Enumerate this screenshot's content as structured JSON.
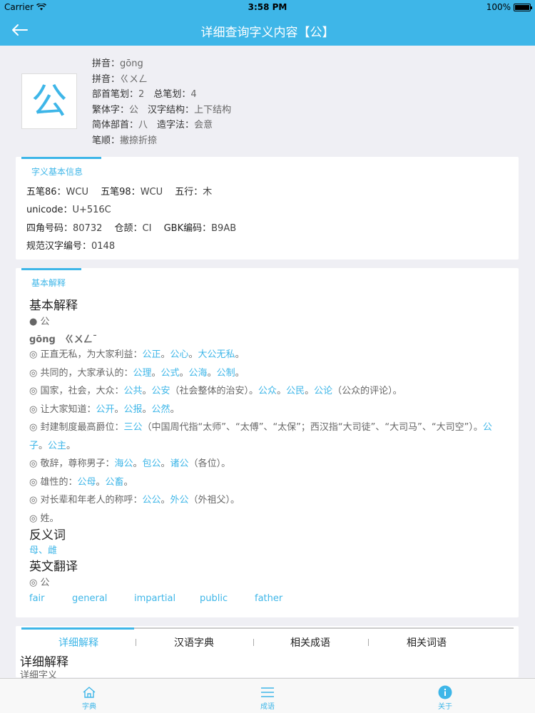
{
  "status_bar": {
    "carrier": "Carrier",
    "time": "3:58 PM",
    "battery": "100%"
  },
  "nav": {
    "title": "详细查询字义内容【公】"
  },
  "character": "公",
  "info": {
    "pinyin_label": "拼音：",
    "pinyin": "gōng",
    "zhuyin_label": "拼音：",
    "zhuyin": "ㄍㄨㄥ",
    "radical_strokes_label": "部首笔划：",
    "radical_strokes": "2",
    "total_strokes_label": "总笔划：",
    "total_strokes": "4",
    "traditional_label": "繁体字：",
    "traditional": "公",
    "structure_label": "汉字结构：",
    "structure": "上下结构",
    "simplified_radical_label": "简体部首：",
    "simplified_radical": "八",
    "formation_label": "造字法：",
    "formation": "会意",
    "stroke_order_label": "笔顺：",
    "stroke_order": "撇捺折捺"
  },
  "basic_info": {
    "title": "字义基本信息",
    "wubi86_label": "五笔86：",
    "wubi86": "WCU",
    "wubi98_label": "五笔98：",
    "wubi98": "WCU",
    "wuxing_label": "五行：",
    "wuxing": "木",
    "unicode_label": "unicode：",
    "unicode": "U+516C",
    "sijiao_label": "四角号码：",
    "sijiao": "80732",
    "cangjie_label": "仓颉：",
    "cangjie": "CI",
    "gbk_label": "GBK编码：",
    "gbk": "B9AB",
    "standard_label": "规范汉字编号：",
    "standard": "0148"
  },
  "basic_explain": {
    "tab": "基本解释",
    "heading": "基本解释",
    "bullet": "● 公",
    "pron": "gōng　ㄍㄨㄥˉ",
    "defs": [
      {
        "pre": "◎ 正直无私，为大家利益：",
        "links": [
          "公正",
          "公心",
          "大公无私"
        ],
        "post": ""
      },
      {
        "pre": "◎ 共同的，大家承认的：",
        "links": [
          "公理",
          "公式",
          "公海",
          "公制"
        ],
        "post": ""
      },
      {
        "pre": "◎ 国家，社会，大众：",
        "l1": "公共",
        "m1": "。",
        "l2": "公安",
        "m2": "（社会整体的治安）。",
        "l3": "公众",
        "m3": "。",
        "l4": "公民",
        "m4": "。",
        "l5": "公论",
        "m5": "（公众的评论）。"
      },
      {
        "pre": "◎ 让大家知道：",
        "links": [
          "公开",
          "公报",
          "公然"
        ],
        "post": ""
      },
      {
        "pre": "◎ 封建制度最高爵位：",
        "l1": "三公",
        "m1": "（中国周代指“太师”、“太傅”、“太保”；西汉指“大司徒”、“大司马”、“大司空”）。",
        "l2": "公子",
        "m2": "。",
        "l3": "公主",
        "m3": "。"
      },
      {
        "pre": "◎ 敬辞，尊称男子：",
        "l1": "海公",
        "m1": "。",
        "l2": "包公",
        "m2": "。",
        "l3": "诸公",
        "m3": "（各位）。"
      },
      {
        "pre": "◎ 雄性的：",
        "links": [
          "公母",
          "公畜"
        ],
        "post": ""
      },
      {
        "pre": "◎ 对长辈和年老人的称呼：",
        "l1": "公公",
        "m1": "。",
        "l2": "外公",
        "m2": "（外祖父）。"
      },
      {
        "pre": "◎ 姓。"
      }
    ],
    "antonym_heading": "反义词",
    "antonyms": "母、雌",
    "english_heading": "英文翻译",
    "english_sub": "◎ 公",
    "english": [
      "fair",
      "general",
      "impartial",
      "public",
      "father"
    ]
  },
  "detail": {
    "tabs": [
      "详细解释",
      "汉语字典",
      "相关成语",
      "相关词语"
    ],
    "heading": "详细解释",
    "sub": "详细字义"
  },
  "tab_bar": [
    {
      "label": "字典",
      "icon": "home-icon"
    },
    {
      "label": "成语",
      "icon": "list-icon"
    },
    {
      "label": "关于",
      "icon": "info-icon"
    }
  ],
  "colors": {
    "accent": "#3eb6e8",
    "background": "#efeff4"
  }
}
